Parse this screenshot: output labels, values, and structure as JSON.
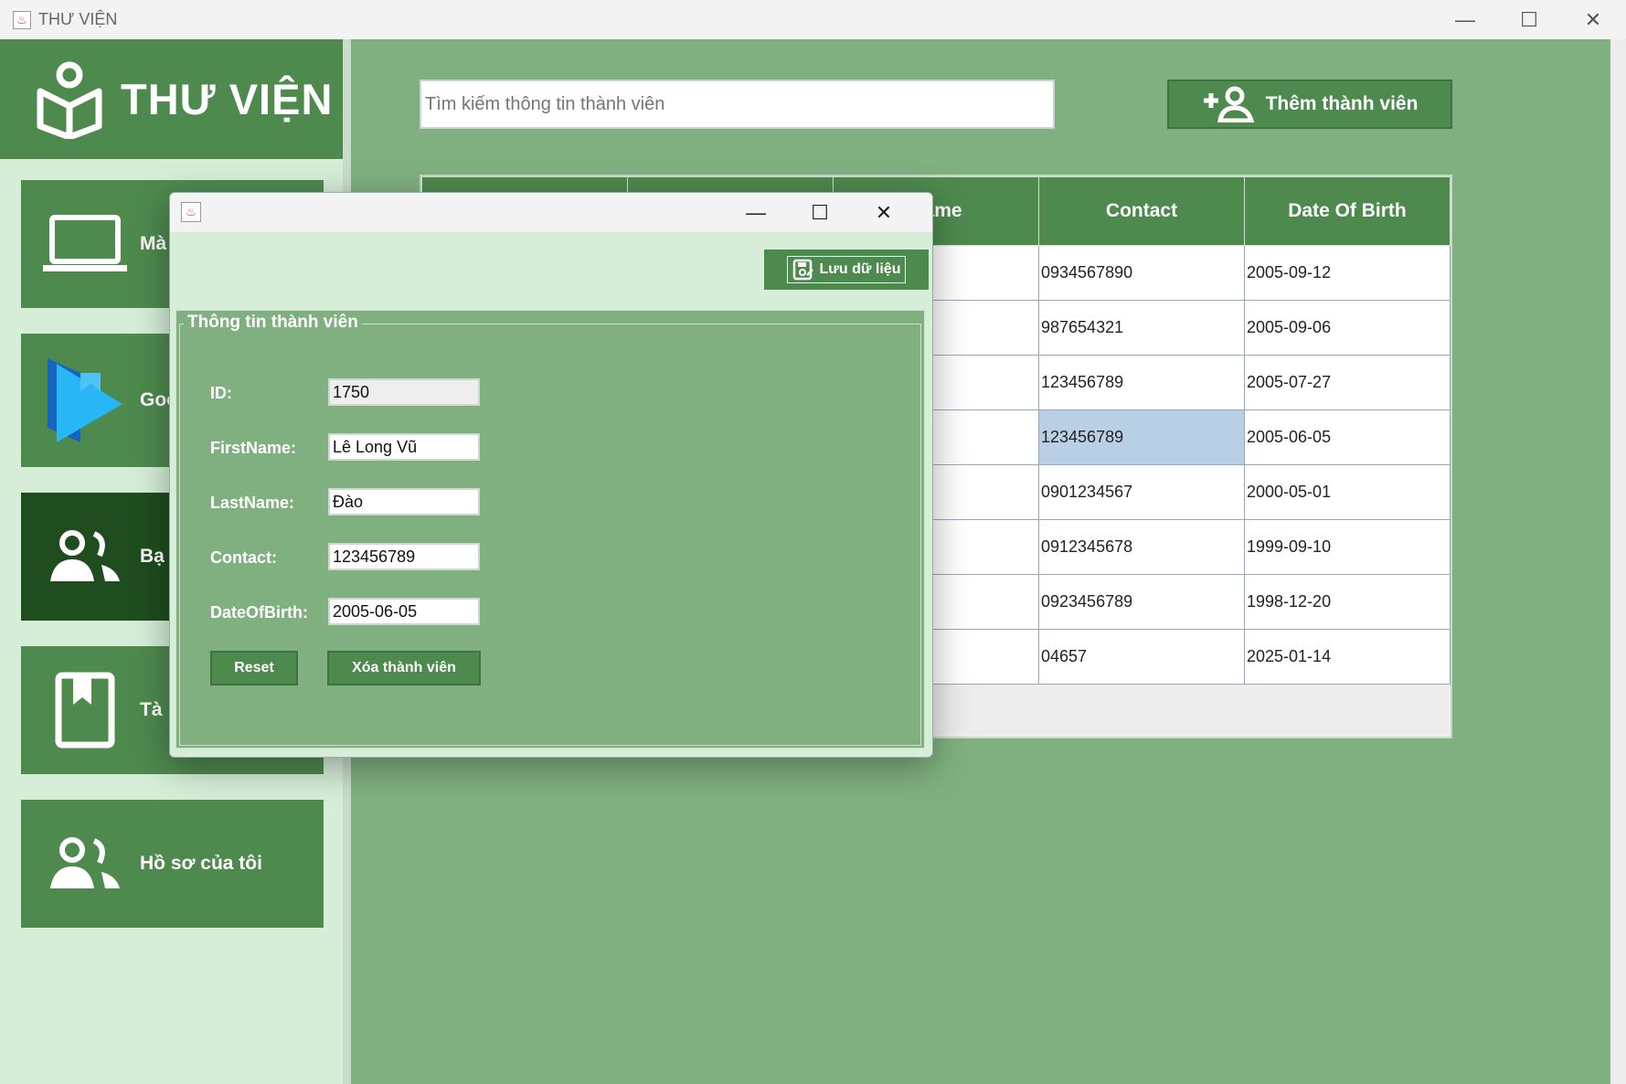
{
  "window": {
    "title": "THƯ VIỆN",
    "minimize_glyph": "—",
    "maximize_glyph": "☐",
    "close_glyph": "✕"
  },
  "sidebar": {
    "logo_text": "THƯ VIỆN",
    "items": [
      {
        "label": "Mà",
        "icon": "laptop-icon"
      },
      {
        "label": "Goo",
        "icon": "google-books-icon"
      },
      {
        "label": "Bạ",
        "icon": "users-icon",
        "active": true
      },
      {
        "label": "Tà",
        "icon": "bookmark-icon"
      },
      {
        "label": "Hồ sơ của tôi",
        "icon": "users-icon"
      }
    ]
  },
  "main": {
    "search_placeholder": "Tìm kiếm thông tin thành viên",
    "add_button": "Thêm thành viên",
    "table": {
      "headers": [
        "",
        "",
        "Name",
        "Contact",
        "Date Of Birth"
      ],
      "rows": [
        [
          "",
          "",
          "",
          "0934567890",
          "2005-09-12"
        ],
        [
          "",
          "",
          "",
          "987654321",
          "2005-09-06"
        ],
        [
          "",
          "",
          "",
          "123456789",
          "2005-07-27"
        ],
        [
          "",
          "",
          "",
          "123456789",
          "2005-06-05"
        ],
        [
          "",
          "",
          "",
          "0901234567",
          "2000-05-01"
        ],
        [
          "",
          "",
          "",
          "0912345678",
          "1999-09-10"
        ],
        [
          "",
          "",
          "",
          "0923456789",
          "1998-12-20"
        ],
        [
          "",
          "",
          "",
          "04657",
          "2025-01-14"
        ]
      ],
      "selected_row": 3
    }
  },
  "dialog": {
    "save_button": "Lưu dữ liệu",
    "panel_title": "Thông tin thành viên",
    "fields": {
      "id_label": "ID:",
      "id_value": "1750",
      "firstname_label": "FirstName:",
      "firstname_value": "Lê Long Vũ",
      "lastname_label": "LastName:",
      "lastname_value": "Đào",
      "contact_label": "Contact:",
      "contact_value": "123456789",
      "dob_label": "DateOfBirth:",
      "dob_value": "2005-06-05"
    },
    "reset_button": "Reset",
    "delete_button": "Xóa thành viên"
  },
  "colors": {
    "primary_green": "#4e8a4e",
    "active_green": "#1f4d1f",
    "main_bg": "#80b080",
    "light_bg": "#d6eed8",
    "selected_cell": "#b8cfe6"
  }
}
